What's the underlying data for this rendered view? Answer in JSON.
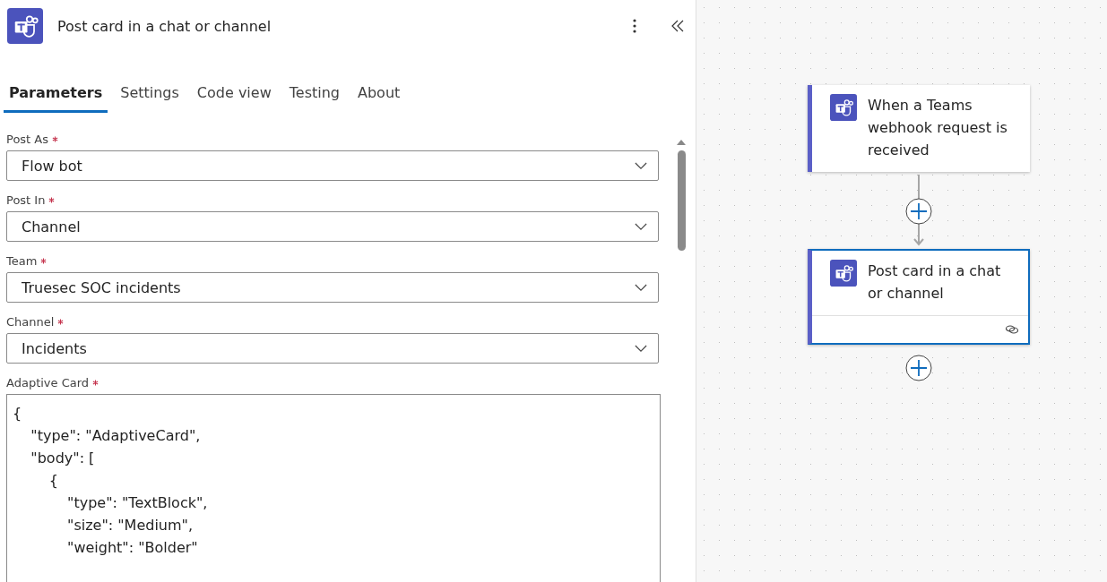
{
  "panel": {
    "title": "Post card in a chat or channel"
  },
  "tabs": [
    {
      "label": "Parameters",
      "selected": true
    },
    {
      "label": "Settings",
      "selected": false
    },
    {
      "label": "Code view",
      "selected": false
    },
    {
      "label": "Testing",
      "selected": false
    },
    {
      "label": "About",
      "selected": false
    }
  ],
  "fields": [
    {
      "label": "Post As",
      "required": true,
      "value": "Flow bot"
    },
    {
      "label": "Post In",
      "required": true,
      "value": "Channel"
    },
    {
      "label": "Team",
      "required": true,
      "value": "Truesec SOC incidents"
    },
    {
      "label": "Channel",
      "required": true,
      "value": "Incidents"
    }
  ],
  "adaptive_card": {
    "label": "Adaptive Card",
    "required": true,
    "value": "{\n    \"type\": \"AdaptiveCard\",\n    \"body\": [\n        {\n            \"type\": \"TextBlock\",\n            \"size\": \"Medium\",\n            \"weight\": \"Bolder\""
  },
  "flow": [
    {
      "title": "When a Teams webhook request is received",
      "selected": false
    },
    {
      "title": "Post card in a chat or channel",
      "selected": true
    }
  ]
}
